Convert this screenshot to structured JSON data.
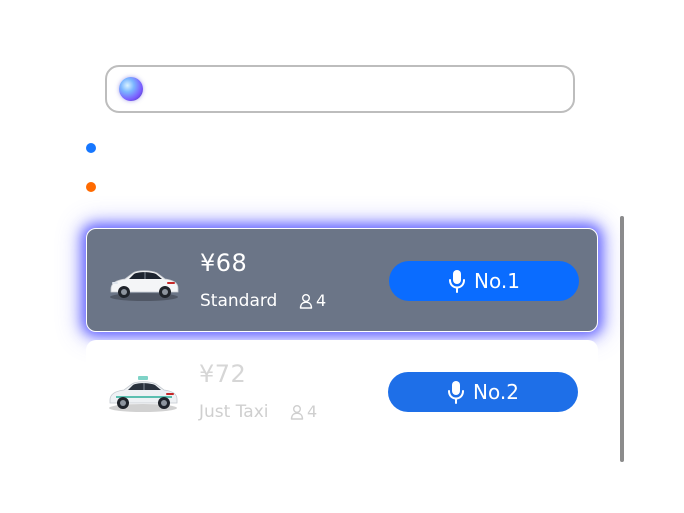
{
  "search": {
    "placeholder": "",
    "value": "",
    "orb_icon": "assistant-orb-icon"
  },
  "route": {
    "pickup_label": "",
    "destination_label": "",
    "pickup_color": "#1677ff",
    "destination_color": "#ff6a00"
  },
  "options": [
    {
      "price": "¥68",
      "service": "Standard",
      "seats": "4",
      "rank_label": "No.1",
      "selected": true,
      "car_icon": "white-sedan-icon"
    },
    {
      "price": "¥72",
      "service": "Just Taxi",
      "seats": "4",
      "rank_label": "No.2",
      "selected": false,
      "car_icon": "taxi-icon"
    }
  ],
  "colors": {
    "accent": "#0a6cff",
    "selected_card": "#6b7587",
    "glow": "#4646ff"
  }
}
